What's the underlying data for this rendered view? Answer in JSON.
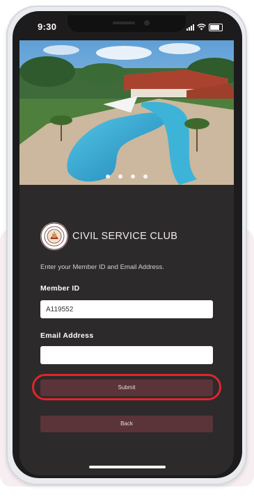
{
  "status_bar": {
    "time": "9:30"
  },
  "hero": {
    "slide_count": 4,
    "active_slide": 1
  },
  "brand": {
    "name": "CIVIL SERVICE CLUB",
    "badge_text": "CIVIL SERVICE CLUB · SINGAPORE"
  },
  "form": {
    "instruction": "Enter your Member ID and Email Address.",
    "member_id_label": "Member ID",
    "member_id_value": "A119552",
    "email_label": "Email Address",
    "email_value": "",
    "submit_label": "Submit",
    "back_label": "Back"
  },
  "colors": {
    "app_background": "#2d2a2b",
    "button_background": "#5a3439",
    "highlight_outline": "#e1252b"
  }
}
